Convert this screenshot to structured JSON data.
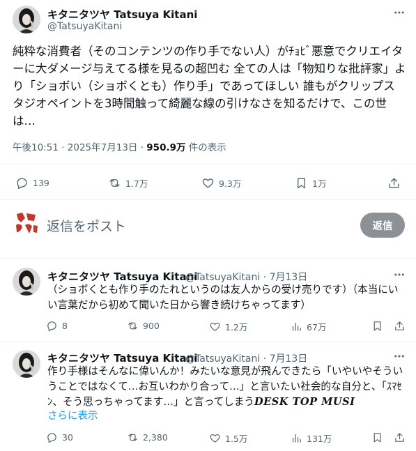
{
  "main_tweet": {
    "author_name": "キタニタツヤ Tatsuya Kitani",
    "author_handle": "@TatsuyaKitani",
    "text": "純粋な消費者（そのコンテンツの作り手でない人）がﾁｮﾋﾞ悪意でクリエイターに大ダメージ与えてる様を見るの超凹む 全ての人は「物知りな批評家」より「ショボい（ショボくとも）作り手」であってほしい 誰もがクリップスタジオペイントを3時間触って綺麗な線の引けなさを知るだけで、この世は…",
    "timestamp": "午後10:51 · 2025年7月13日 · ",
    "views_count": "950.9万",
    "views_label": " 件の表示",
    "stats": {
      "replies": "139",
      "reposts": "1.7万",
      "likes": "9.3万",
      "bookmarks": "1万"
    }
  },
  "reply_composer": {
    "placeholder": "返信をポスト",
    "button_label": "返信"
  },
  "replies": [
    {
      "author_name": "キタニタツヤ Tatsuya Kitani",
      "meta": "@TatsuyaKitani · 7月13日",
      "text": "（ショボくとも作り手のたれというのは友人からの受け売りです）（本当にいい言葉だから初めて聞いた日から響き続けちゃってます）",
      "stats": {
        "replies": "8",
        "reposts": "900",
        "likes": "1.2万",
        "views": "67万"
      }
    },
    {
      "author_name": "キタニタツヤ Tatsuya Kitani",
      "meta": "@TatsuyaKitani · 7月13日",
      "text_main": "作り手様はそんなに偉いんか！みたいな意見が飛んできたら「いやいやそういうことではなくて…お互いわかり合って…」と言いたい社会的な自分と、「ｽﾏｾﾝ、そう思っちゃってます…」と言ってしまう",
      "text_tail": "DESK TOP MUSI",
      "show_more": "さらに表示",
      "stats": {
        "replies": "30",
        "reposts": "2,380",
        "likes": "1.5万",
        "views": "131万"
      }
    }
  ],
  "colors": {
    "text_primary": "#0f1419",
    "text_secondary": "#536471",
    "link": "#1d9bf0",
    "reply_button": "#8b9196",
    "divider": "#eff3f4"
  },
  "icons": [
    "more-icon",
    "reply-icon",
    "repost-icon",
    "like-icon",
    "bookmark-icon",
    "share-icon",
    "views-icon"
  ]
}
